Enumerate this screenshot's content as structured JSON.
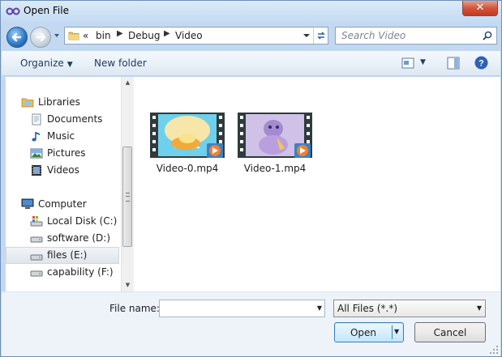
{
  "window": {
    "title": "Open File",
    "close_label": "✕"
  },
  "address_bar": {
    "overflow": "«",
    "breadcrumbs": [
      "bin",
      "Debug",
      "Video"
    ]
  },
  "search": {
    "placeholder": "Search Video"
  },
  "toolbar": {
    "organize_label": "Organize",
    "new_folder_label": "New folder"
  },
  "nav_pane": {
    "items": [
      {
        "label": "Libraries",
        "icon": "libraries-icon"
      },
      {
        "label": "Documents",
        "icon": "documents-icon"
      },
      {
        "label": "Music",
        "icon": "music-icon"
      },
      {
        "label": "Pictures",
        "icon": "pictures-icon"
      },
      {
        "label": "Videos",
        "icon": "videos-icon"
      },
      {
        "label": "Computer",
        "icon": "computer-icon"
      },
      {
        "label": "Local Disk (C:)",
        "icon": "system-drive-icon"
      },
      {
        "label": "software (D:)",
        "icon": "drive-icon"
      },
      {
        "label": "files (E:)",
        "icon": "drive-icon",
        "selected": true
      },
      {
        "label": "capability (F:)",
        "icon": "drive-icon"
      }
    ]
  },
  "files": [
    {
      "name": "Video-0.mp4",
      "icon": "video-thumbnail"
    },
    {
      "name": "Video-1.mp4",
      "icon": "video-thumbnail"
    }
  ],
  "footer": {
    "file_name_label": "File name:",
    "file_name_value": "",
    "filter_value": "All Files (*.*)",
    "open_label": "Open",
    "cancel_label": "Cancel"
  },
  "colors": {
    "accent": "#2a76c6",
    "selection": "#e0e5eb",
    "chrome": "#c2d9f1"
  }
}
